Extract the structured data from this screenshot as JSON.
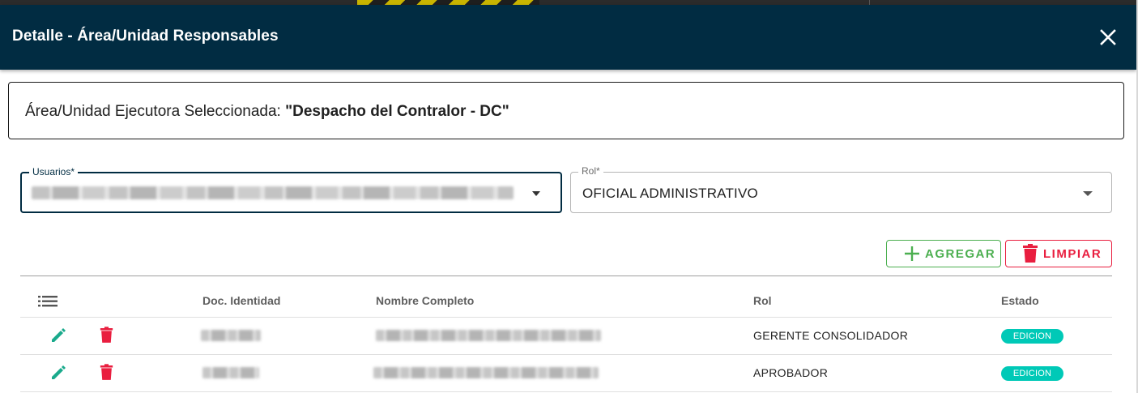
{
  "dialog": {
    "title": "Detalle - Área/Unidad Responsables"
  },
  "selection": {
    "label": "Área/Unidad Ejecutora Seleccionada: ",
    "value": "\"Despacho del Contralor - DC\""
  },
  "form": {
    "usuarios": {
      "label": "Usuarios*",
      "value": ""
    },
    "rol": {
      "label": "Rol*",
      "value": "OFICIAL ADMINISTRATIVO"
    }
  },
  "actions": {
    "agregar_label": "AGREGAR",
    "limpiar_label": "LIMPIAR"
  },
  "table": {
    "columns": [
      "",
      "Doc. Identidad",
      "Nombre Completo",
      "Rol",
      "Estado"
    ],
    "rows": [
      {
        "doc": "",
        "nombre": "",
        "rol": "GERENTE CONSOLIDADOR",
        "estado": "EDICION"
      },
      {
        "doc": "",
        "nombre": "",
        "rol": "APROBADOR",
        "estado": "EDICION"
      }
    ]
  },
  "icons": {
    "close": "close-icon",
    "list": "list-icon",
    "edit": "pencil-icon",
    "delete": "trash-icon",
    "add": "plus-icon"
  },
  "colors": {
    "header_bg": "#012c42",
    "success": "#4caf50",
    "danger": "#e91e3f",
    "edit_icon": "#1aaa8c",
    "badge": "#00c9b7"
  }
}
